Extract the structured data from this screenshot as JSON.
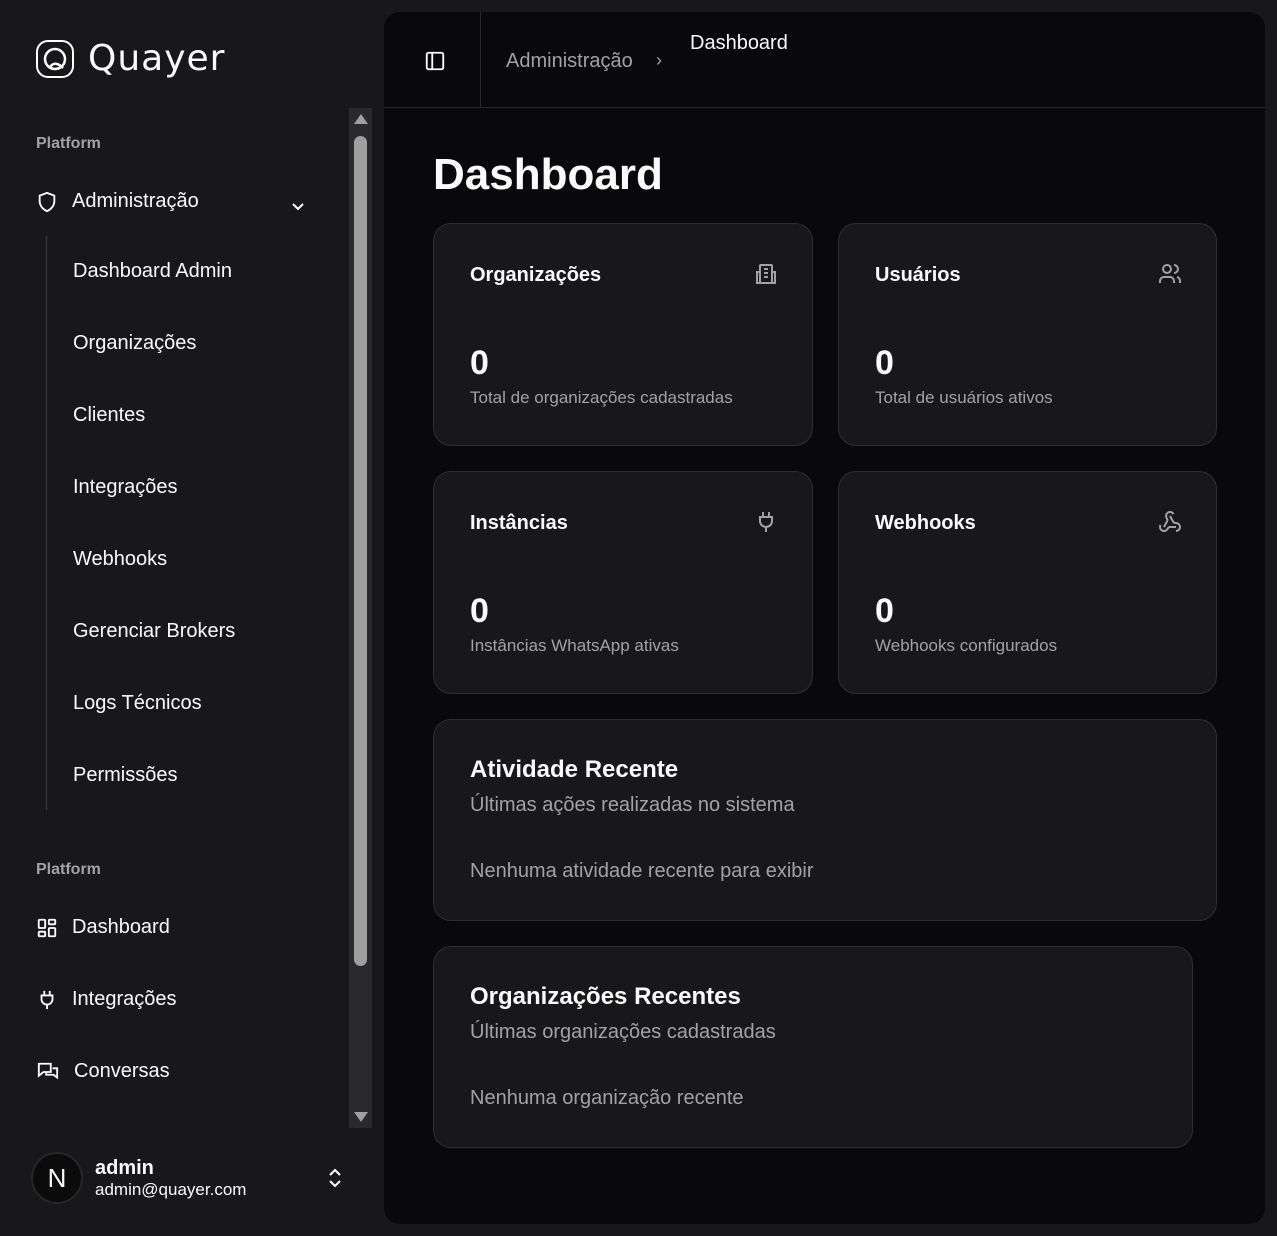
{
  "brand": {
    "name": "Quayer"
  },
  "sidebar": {
    "group1_label": "Platform",
    "admin": {
      "label": "Administração",
      "icon": "shield-icon"
    },
    "admin_items": [
      "Dashboard Admin",
      "Organizações",
      "Clientes",
      "Integrações",
      "Webhooks",
      "Gerenciar Brokers",
      "Logs Técnicos",
      "Permissões"
    ],
    "group2_label": "Platform",
    "items": [
      {
        "label": "Dashboard",
        "icon": "layout-grid-icon"
      },
      {
        "label": "Integrações",
        "icon": "plug-icon"
      },
      {
        "label": "Conversas",
        "icon": "messages-icon"
      }
    ],
    "user": {
      "initial": "N",
      "name": "admin",
      "email": "admin@quayer.com"
    }
  },
  "header": {
    "breadcrumb": [
      "Administração",
      "Dashboard"
    ]
  },
  "page": {
    "title": "Dashboard"
  },
  "stats": [
    {
      "title": "Organizações",
      "value": "0",
      "desc": "Total de organizações cadastradas",
      "icon": "building-icon"
    },
    {
      "title": "Usuários",
      "value": "0",
      "desc": "Total de usuários ativos",
      "icon": "users-icon"
    },
    {
      "title": "Instâncias",
      "value": "0",
      "desc": "Instâncias WhatsApp ativas",
      "icon": "plug-icon"
    },
    {
      "title": "Webhooks",
      "value": "0",
      "desc": "Webhooks configurados",
      "icon": "webhook-icon"
    }
  ],
  "activity": {
    "title": "Atividade Recente",
    "subtitle": "Últimas ações realizadas no sistema",
    "empty": "Nenhuma atividade recente para exibir"
  },
  "recent_orgs": {
    "title": "Organizações Recentes",
    "subtitle": "Últimas organizações cadastradas",
    "empty": "Nenhuma organização recente"
  }
}
